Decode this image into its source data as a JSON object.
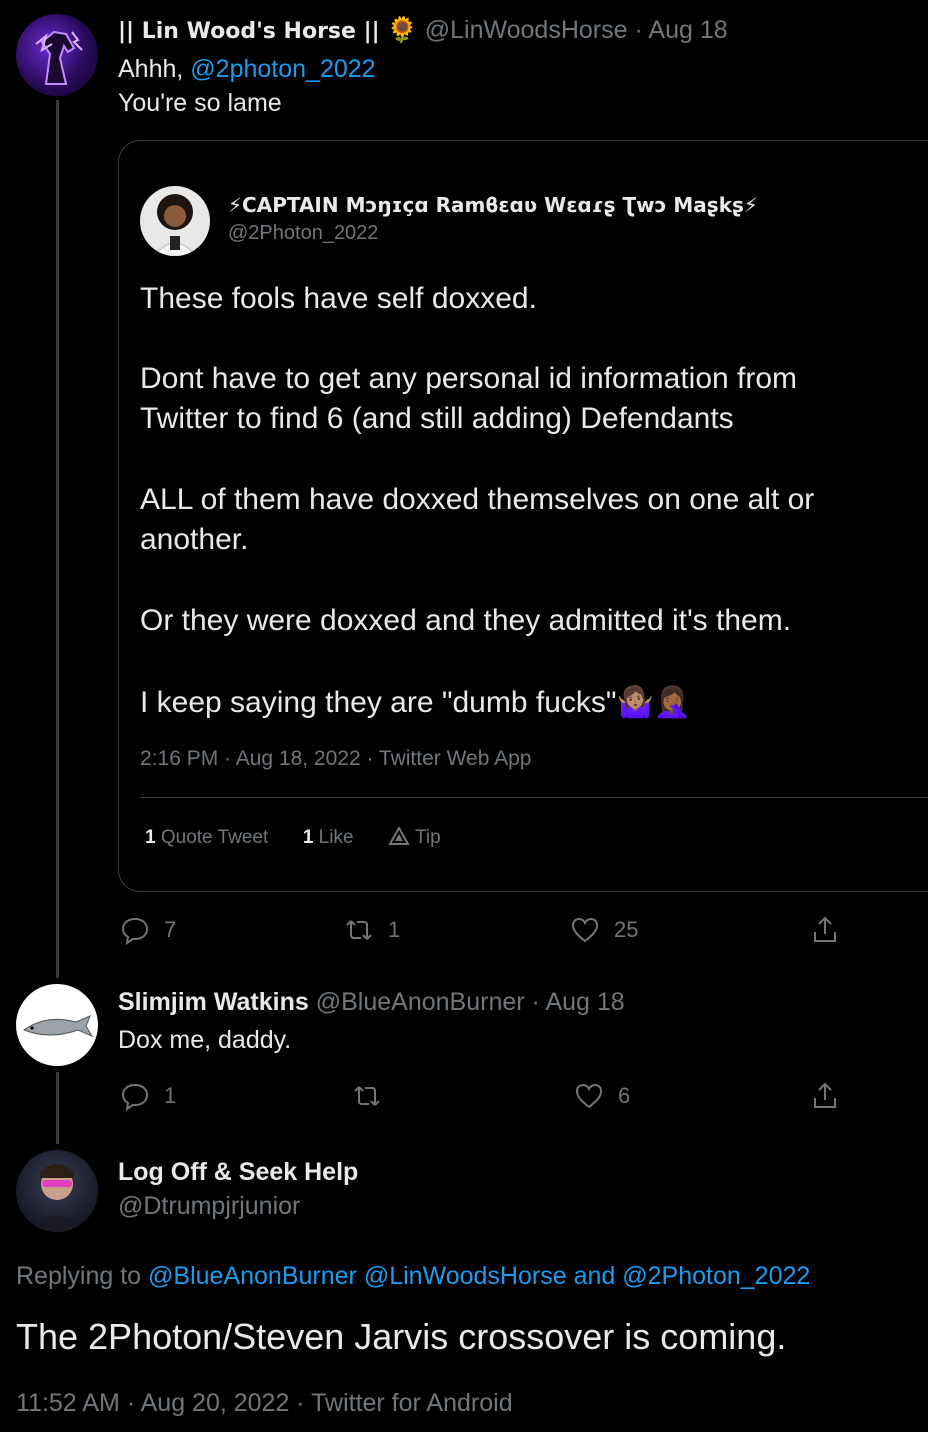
{
  "tweet1": {
    "display_name": "|| Lin Wood's Horse ||",
    "name_emoji": "🌻",
    "handle": "@LinWoodsHorse",
    "sep": "·",
    "date": "Aug 18",
    "line1_prefix": "Ahhh,",
    "line1_mention": "@2photon_2022",
    "line2": "You're so lame",
    "reply_count": "7",
    "retweet_count": "1",
    "like_count": "25"
  },
  "quote": {
    "display_name": "⚡CAPTAIN Mɔŋɪçɑ Ramϐɛɑʋ Wɛɑɾʂ Ʈwɔ Maʂkʂ⚡",
    "handle": "@2Photon_2022",
    "p1": "These fools have self doxxed.",
    "p2a": "Dont have to get any personal id information from",
    "p2b": "Twitter to find 6 (and still adding) Defendants",
    "p3a": "ALL of them have doxxed themselves on one alt or",
    "p3b": "another.",
    "p4": "Or they were doxxed and they admitted it's them.",
    "p5": "I keep saying they are \"dumb fucks\"🤷🏽‍♀️🤦🏾‍♀️",
    "meta": "2:16 PM · Aug 18, 2022 · Twitter Web App",
    "quote_tweet_count": "1",
    "quote_tweet_label": "Quote Tweet",
    "like_count": "1",
    "like_label": "Like",
    "tip_label": "Tip"
  },
  "tweet2": {
    "display_name": "Slimjim Watkins",
    "handle": "@BlueAnonBurner",
    "sep": "·",
    "date": "Aug 18",
    "text": "Dox me, daddy.",
    "reply_count": "1",
    "like_count": "6"
  },
  "tweet3": {
    "display_name": "Log Off & Seek Help",
    "handle": "@Dtrumpjrjunior",
    "replying_prefix": "Replying to",
    "mention1": "@BlueAnonBurner",
    "mention2": "@LinWoodsHorse",
    "and_word": "and",
    "mention3": "@2Photon_2022",
    "text": "The 2Photon/Steven Jarvis crossover is coming.",
    "meta": "11:52 AM · Aug 20, 2022 · Twitter for Android"
  },
  "icons": {
    "reply": "reply-icon",
    "retweet": "retweet-icon",
    "like": "heart-icon",
    "share": "share-icon",
    "tip": "tip-icon"
  },
  "colors": {
    "link": "#1d9bf0",
    "muted": "#71767b",
    "background": "#000000"
  }
}
